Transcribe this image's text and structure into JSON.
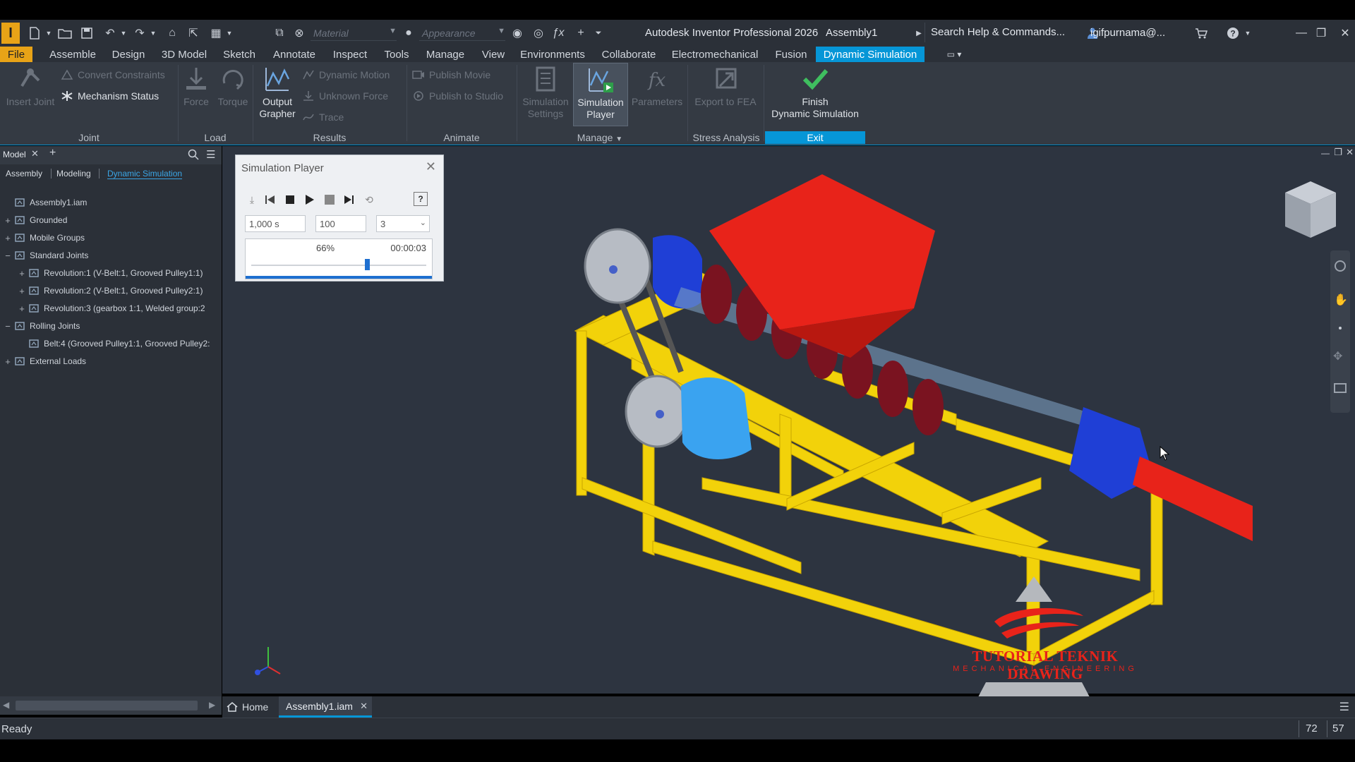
{
  "titlebar": {
    "material_placeholder": "Material",
    "appearance_placeholder": "Appearance",
    "app_title": "Autodesk Inventor Professional 2026",
    "document_title": "Assembly1",
    "search_text": "Search Help & Commands...",
    "user_name": "igifpurnama@..."
  },
  "menu": {
    "file": "File",
    "tabs": [
      "Assemble",
      "Design",
      "3D Model",
      "Sketch",
      "Annotate",
      "Inspect",
      "Tools",
      "Manage",
      "View",
      "Environments",
      "Collaborate",
      "Electromechanical",
      "Fusion",
      "Dynamic Simulation"
    ],
    "active_tab": "Dynamic Simulation"
  },
  "ribbon": {
    "joint": {
      "insert_joint": "Insert Joint",
      "convert_constraints": "Convert Constraints",
      "mechanism_status": "Mechanism Status",
      "label": "Joint"
    },
    "load": {
      "force": "Force",
      "torque": "Torque",
      "label": "Load"
    },
    "results": {
      "output_grapher_1": "Output",
      "output_grapher_2": "Grapher",
      "dynamic_motion": "Dynamic Motion",
      "unknown_force": "Unknown Force",
      "trace": "Trace",
      "label": "Results"
    },
    "animate": {
      "publish_movie": "Publish Movie",
      "publish_studio": "Publish to Studio",
      "label": "Animate"
    },
    "manage": {
      "sim_settings_1": "Simulation",
      "sim_settings_2": "Settings",
      "sim_player_1": "Simulation",
      "sim_player_2": "Player",
      "parameters": "Parameters",
      "label": "Manage"
    },
    "stress": {
      "export_fea": "Export to FEA",
      "label": "Stress Analysis"
    },
    "exit": {
      "finish_1": "Finish",
      "finish_2": "Dynamic Simulation",
      "label": "Exit"
    }
  },
  "browser": {
    "title": "Model",
    "tabs": [
      "Assembly",
      "Modeling",
      "Dynamic Simulation"
    ],
    "tree": [
      {
        "label": "Assembly1.iam",
        "pm": ""
      },
      {
        "label": "Grounded",
        "pm": "+"
      },
      {
        "label": "Mobile Groups",
        "pm": "+"
      },
      {
        "label": "Standard Joints",
        "pm": "−"
      },
      {
        "label": "Revolution:1 (V-Belt:1, Grooved Pulley1:1)",
        "pm": "+"
      },
      {
        "label": "Revolution:2 (V-Belt:1, Grooved Pulley2:1)",
        "pm": "+"
      },
      {
        "label": "Revolution:3 (gearbox 1:1, Welded group:2",
        "pm": "+"
      },
      {
        "label": "Rolling Joints",
        "pm": "−"
      },
      {
        "label": "Belt:4 (Grooved Pulley1:1, Grooved Pulley2:",
        "pm": ""
      },
      {
        "label": "External Loads",
        "pm": "+"
      }
    ]
  },
  "sim_player": {
    "title": "Simulation Player",
    "final_time": "1,000 s",
    "images": "100",
    "filter": "3",
    "percent": "66%",
    "elapsed": "00:00:03",
    "progress": 0.66
  },
  "viewport": {
    "watermark_line1": "TUTORIAL TEKNIK DRAWING",
    "watermark_line2": "MECHANICAL ENGINEERING"
  },
  "doc_tabs": {
    "home": "Home",
    "assembly": "Assembly1.iam"
  },
  "status": {
    "text": "Ready",
    "count1": "72",
    "count2": "57"
  }
}
